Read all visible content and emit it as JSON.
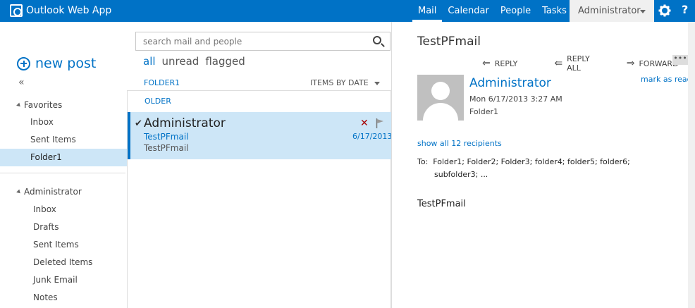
{
  "app": {
    "title": "Outlook Web App"
  },
  "nav": {
    "mail": "Mail",
    "calendar": "Calendar",
    "people": "People",
    "tasks": "Tasks",
    "user": "Administrator",
    "help": "?"
  },
  "left": {
    "new_post": "new post",
    "collapse": "«",
    "favorites_label": "Favorites",
    "favorites": [
      {
        "label": "Inbox"
      },
      {
        "label": "Sent Items"
      },
      {
        "label": "Folder1"
      }
    ],
    "mailbox_label": "Administrator",
    "mailbox": [
      {
        "label": "Inbox"
      },
      {
        "label": "Drafts"
      },
      {
        "label": "Sent Items"
      },
      {
        "label": "Deleted Items"
      },
      {
        "label": "Junk Email"
      },
      {
        "label": "Notes"
      }
    ]
  },
  "middle": {
    "search_placeholder": "search mail and people",
    "filters": {
      "all": "all",
      "unread": "unread",
      "flagged": "flagged"
    },
    "folder": "FOLDER1",
    "sort": "ITEMS BY DATE",
    "group": "OLDER",
    "item": {
      "sender": "Administrator",
      "subject": "TestPFmail",
      "preview": "TestPFmail",
      "date": "6/17/2013"
    }
  },
  "reading": {
    "subject": "TestPFmail",
    "actions": {
      "reply": "REPLY",
      "reply_all": "REPLY ALL",
      "forward": "FORWARD",
      "more": "•••"
    },
    "from": "Administrator",
    "date": "Mon 6/17/2013 3:27 AM",
    "folder": "Folder1",
    "mark_as_read": "mark as read",
    "show_recipients": "show all 12 recipients",
    "to_label": "To:",
    "to_line1": "Folder1;  Folder2;  Folder3;  folder4;  folder5;  folder6;",
    "to_line2": "subfolder3;  ...",
    "body": "TestPFmail"
  },
  "colors": {
    "accent": "#0072c6",
    "selected": "#cde6f7",
    "delete": "#a80000"
  }
}
